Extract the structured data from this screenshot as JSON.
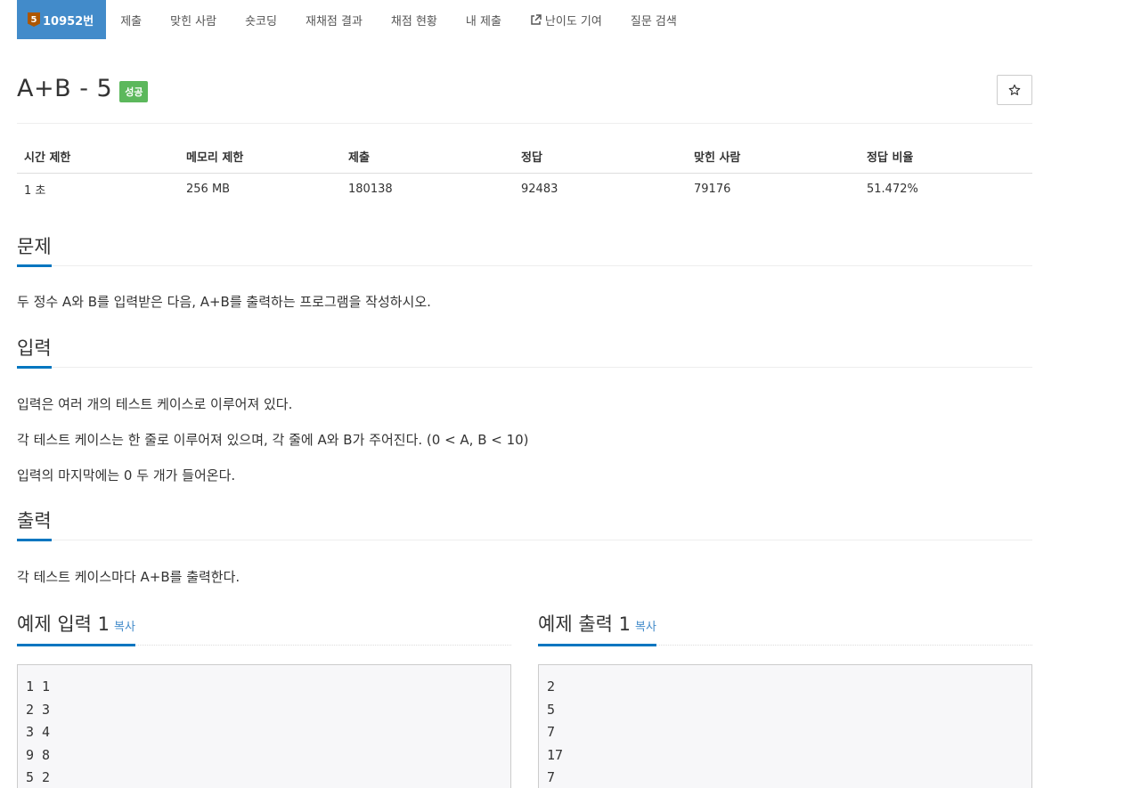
{
  "tabs": [
    {
      "badge": "5",
      "label": "10952번",
      "active": true
    },
    {
      "label": "제출"
    },
    {
      "label": "맞힌 사람"
    },
    {
      "label": "숏코딩"
    },
    {
      "label": "재채점 결과"
    },
    {
      "label": "채점 현황"
    },
    {
      "label": "내 제출"
    },
    {
      "label": "난이도 기여",
      "icon": "external-link-icon"
    },
    {
      "label": "질문 검색"
    }
  ],
  "problem": {
    "title": "A+B - 5",
    "result_badge": "성공",
    "star_icon": "star-outline-icon"
  },
  "info": {
    "headers": [
      "시간 제한",
      "메모리 제한",
      "제출",
      "정답",
      "맞힌 사람",
      "정답 비율"
    ],
    "values": [
      "1 초",
      "256 MB",
      "180138",
      "92483",
      "79176",
      "51.472%"
    ]
  },
  "sections": {
    "problem_heading": "문제",
    "problem_text": "두 정수 A와 B를 입력받은 다음, A+B를 출력하는 프로그램을 작성하시오.",
    "input_heading": "입력",
    "input_lines": [
      "입력은 여러 개의 테스트 케이스로 이루어져 있다.",
      "각 테스트 케이스는 한 줄로 이루어져 있으며, 각 줄에 A와 B가 주어진다. (0 < A, B < 10)",
      "입력의 마지막에는 0 두 개가 들어온다."
    ],
    "output_heading": "출력",
    "output_text": "각 테스트 케이스마다 A+B를 출력한다."
  },
  "samples": {
    "input_heading": "예제 입력 1",
    "output_heading": "예제 출력 1",
    "copy_label": "복사",
    "input_lines": [
      "1 1",
      "2 3",
      "3 4",
      "9 8",
      "5 2"
    ],
    "output_lines": [
      "2",
      "5",
      "7",
      "17",
      "7"
    ]
  },
  "colors": {
    "tab_active": "#428bca",
    "badge_tier": "#ad5600",
    "result_success": "#5cb85c",
    "section_underline": "#0076c0"
  }
}
